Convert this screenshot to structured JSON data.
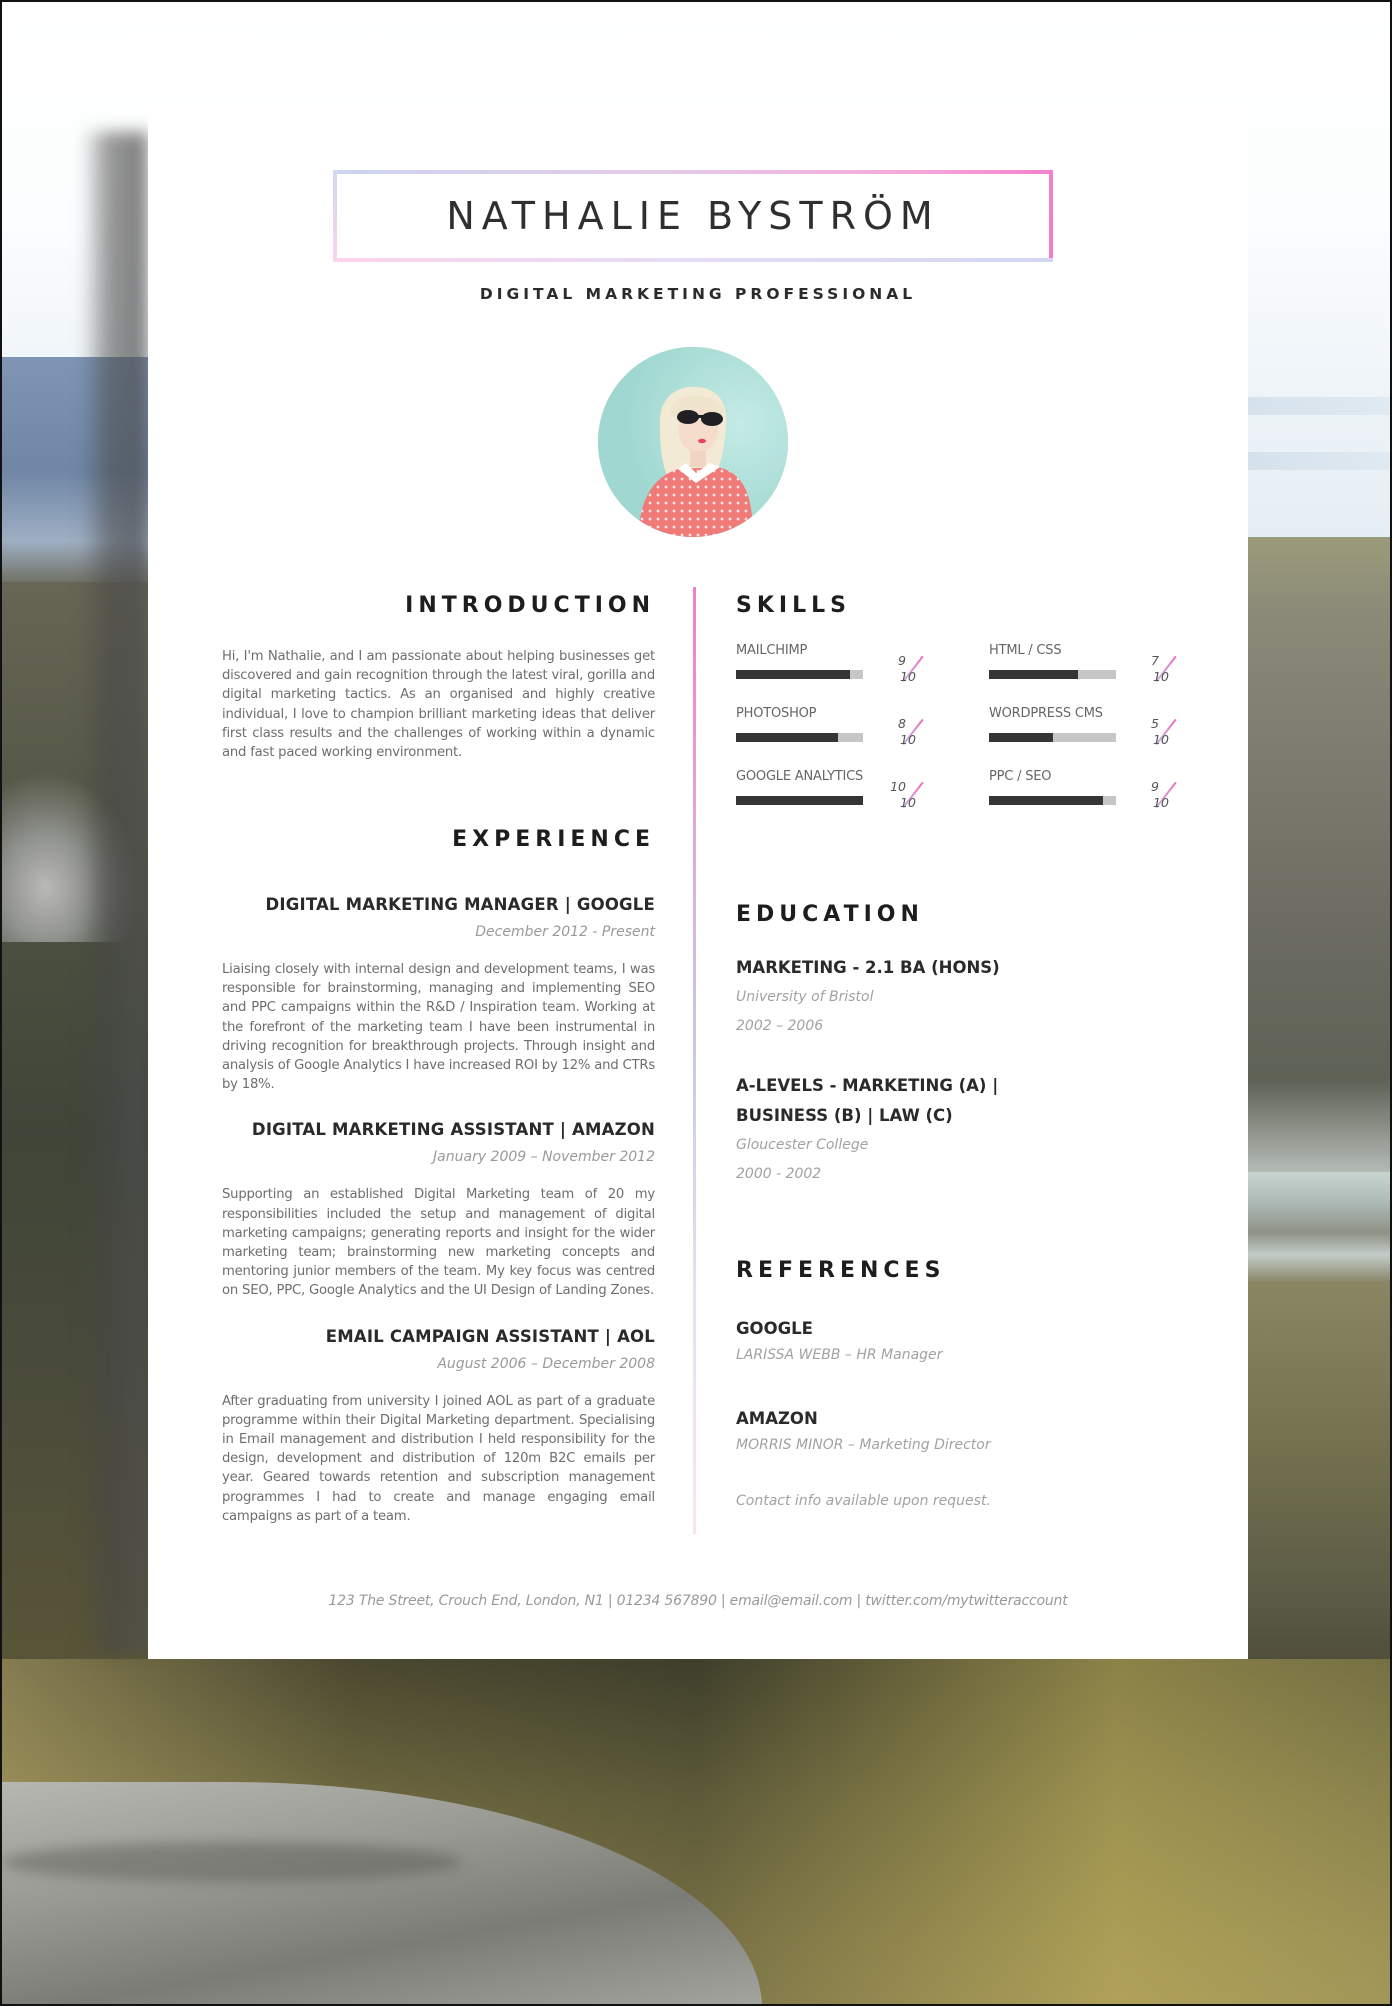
{
  "header": {
    "name": "NATHALIE BYSTRÖM",
    "title": "DIGITAL MARKETING PROFESSIONAL"
  },
  "photo": {
    "alt": "Portrait photo of woman with sunglasses and polka dot top"
  },
  "introduction": {
    "heading": "INTRODUCTION",
    "text": "Hi, I'm Nathalie, and I am passionate about helping businesses get discovered and gain recognition through the latest viral, gorilla and digital marketing tactics.  As an organised and highly creative individual, I love to champion brilliant marketing ideas that deliver first class results and the challenges of working within a dynamic and fast paced working environment."
  },
  "experience": {
    "heading": "EXPERIENCE",
    "jobs": [
      {
        "title": "DIGITAL MARKETING MANAGER | GOOGLE",
        "dates": "December 2012 - Present",
        "description": "Liaising closely with internal design and development teams, I was responsible for brainstorming, managing and implementing SEO and PPC campaigns within the R&D / Inspiration team.  Working at the forefront of the marketing team I have been instrumental in driving recognition for breakthrough projects.  Through insight and analysis of Google Analytics I have increased ROI by 12% and CTRs by 18%."
      },
      {
        "title": "DIGITAL MARKETING ASSISTANT | AMAZON",
        "dates": "January 2009 – November 2012",
        "description": "Supporting an established Digital Marketing team of 20 my responsibilities included the setup and management of digital marketing campaigns; generating reports and insight for the wider marketing team; brainstorming new marketing concepts and mentoring junior members of the team.  My key focus was centred on SEO, PPC, Google Analytics and the UI Design of Landing Zones."
      },
      {
        "title": "EMAIL CAMPAIGN ASSISTANT | AOL",
        "dates": "August 2006 – December 2008",
        "description": "After graduating from university I joined AOL as part of a graduate programme within their Digital Marketing department.  Specialising in Email management and distribution I held responsibility for the design, development and distribution of 120m B2C emails per year.  Geared towards retention and subscription management programmes I had to create and manage engaging email campaigns as part of a team."
      }
    ]
  },
  "skills": {
    "heading": "SKILLS",
    "max": 10,
    "items": [
      {
        "name": "MAILCHIMP",
        "score": 9,
        "max_label": "10"
      },
      {
        "name": "HTML / CSS",
        "score": 7,
        "max_label": "10"
      },
      {
        "name": "PHOTOSHOP",
        "score": 8,
        "max_label": "10"
      },
      {
        "name": "WORDPRESS CMS",
        "score": 5,
        "max_label": "10"
      },
      {
        "name": "GOOGLE ANALYTICS",
        "score": 10,
        "max_label": "10"
      },
      {
        "name": "PPC / SEO",
        "score": 9,
        "max_label": "10"
      }
    ]
  },
  "education": {
    "heading": "EDUCATION",
    "items": [
      {
        "title": "MARKETING - 2.1 BA (HONS)",
        "institution": "University of Bristol",
        "years": "2002 – 2006"
      },
      {
        "title_line1": "A-LEVELS - MARKETING (A) |",
        "title_line2": "BUSINESS (B) | LAW (C)",
        "institution": "Gloucester College",
        "years": "2000 - 2002"
      }
    ]
  },
  "references": {
    "heading": "REFERENCES",
    "items": [
      {
        "company": "GOOGLE",
        "person": "LARISSA WEBB – HR Manager"
      },
      {
        "company": "AMAZON",
        "person": "MORRIS MINOR – Marketing Director"
      }
    ],
    "note": "Contact info available upon request."
  },
  "footer": {
    "contact": "123 The Street, Crouch End, London, N1  |  01234 567890  |  email@email.com  |  twitter.com/mytwitteraccount"
  },
  "colors": {
    "accent_pink": "#f27ccb",
    "accent_lavender": "#ccd5f1",
    "text_dark": "#2a2a2a",
    "text_muted": "#6e6e6e",
    "bar_fill": "#353535",
    "bar_track": "#c6c6c6",
    "photo_bg": "#a8ddd6"
  }
}
